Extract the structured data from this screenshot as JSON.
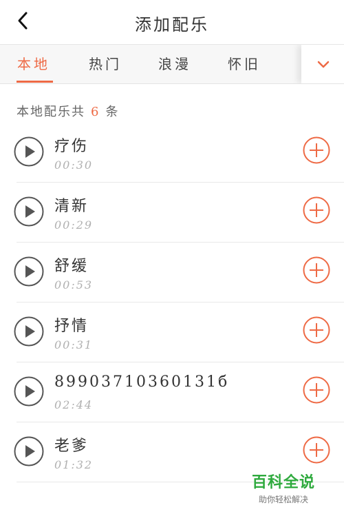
{
  "header": {
    "title": "添加配乐",
    "back_icon": "chevron-left-icon"
  },
  "tabs": [
    {
      "label": "本地",
      "active": true
    },
    {
      "label": "热门",
      "active": false
    },
    {
      "label": "浪漫",
      "active": false
    },
    {
      "label": "怀旧",
      "active": false
    }
  ],
  "tab_more_icon": "chevron-down-icon",
  "count": {
    "prefix": "本地配乐共",
    "value": "6",
    "suffix": "条"
  },
  "songs": [
    {
      "title": "疗伤",
      "duration": "00:30"
    },
    {
      "title": "清新",
      "duration": "00:29"
    },
    {
      "title": "舒缓",
      "duration": "00:53"
    },
    {
      "title": "抒情",
      "duration": "00:31"
    },
    {
      "title": "89903710360131б",
      "duration": "02:44"
    },
    {
      "title": "老爹",
      "duration": "01:32"
    }
  ],
  "watermark": {
    "brand": "百科全说",
    "slogan": "助你轻松解决"
  },
  "colors": {
    "accent": "#ee6a45",
    "tabbar_bg": "#f7f7f7",
    "duration_text": "#b0b0b0",
    "watermark_green": "#2faa3e"
  }
}
